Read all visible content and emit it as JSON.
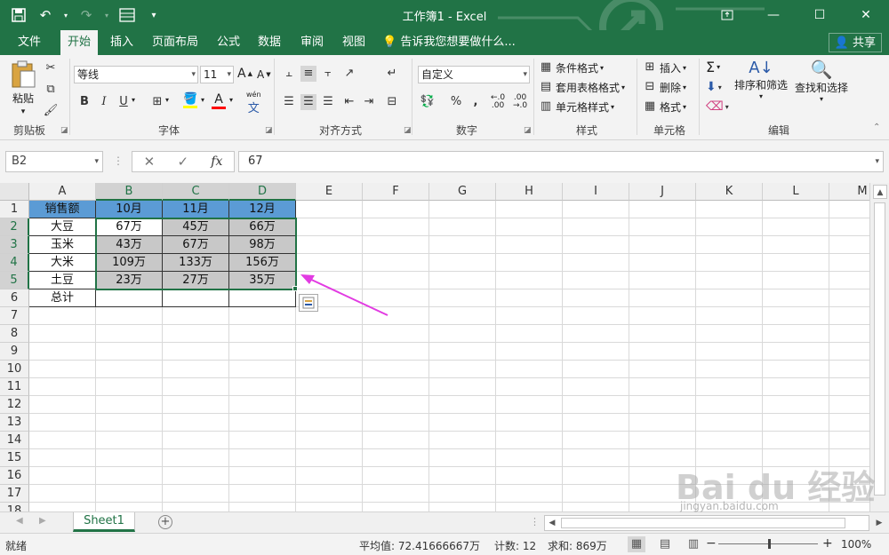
{
  "window": {
    "title": "工作簿1 - Excel",
    "share_label": "共享"
  },
  "tabs": [
    "文件",
    "开始",
    "插入",
    "页面布局",
    "公式",
    "数据",
    "审阅",
    "视图"
  ],
  "tell_me": "告诉我您想要做什么...",
  "ribbon": {
    "paste": "粘贴",
    "font_name": "等线",
    "font_size": "11",
    "number_format": "自定义",
    "conditional_format": "条件格式",
    "table_format": "套用表格格式",
    "cell_style": "单元格样式",
    "insert": "插入",
    "delete": "删除",
    "format": "格式",
    "sort_filter": "排序和筛选",
    "find_select": "查找和选择",
    "wen": "wén",
    "groups": [
      "剪贴板",
      "字体",
      "对齐方式",
      "数字",
      "样式",
      "单元格",
      "编辑"
    ]
  },
  "formula_bar": {
    "name_box": "B2",
    "fx": "fx",
    "value": "67"
  },
  "columns": [
    "A",
    "B",
    "C",
    "D",
    "E",
    "F",
    "G",
    "H",
    "I",
    "J",
    "K",
    "L",
    "M"
  ],
  "rows": [
    "1",
    "2",
    "3",
    "4",
    "5",
    "6",
    "7",
    "8",
    "9",
    "10",
    "11",
    "12",
    "13",
    "14",
    "15",
    "16",
    "17",
    "18"
  ],
  "cells": [
    [
      "销售额",
      "10月",
      "11月",
      "12月"
    ],
    [
      "大豆",
      "67万",
      "45万",
      "66万"
    ],
    [
      "玉米",
      "43万",
      "67万",
      "98万"
    ],
    [
      "大米",
      "109万",
      "133万",
      "156万"
    ],
    [
      "土豆",
      "23万",
      "27万",
      "35万"
    ],
    [
      "总计",
      "",
      "",
      ""
    ]
  ],
  "sheet_tab": "Sheet1",
  "status": {
    "ready": "就绪",
    "average": "平均值: 72.41666667万",
    "count": "计数: 12",
    "sum": "求和: 869万",
    "zoom": "100%"
  },
  "watermark": {
    "brand": "Bai du 经验",
    "url": "jingyan.baidu.com"
  },
  "colors": {
    "excel_green": "#217346",
    "header_fill": "#5b9bd5",
    "selection_fill": "#c8c8c8",
    "arrow": "#e23be2"
  }
}
